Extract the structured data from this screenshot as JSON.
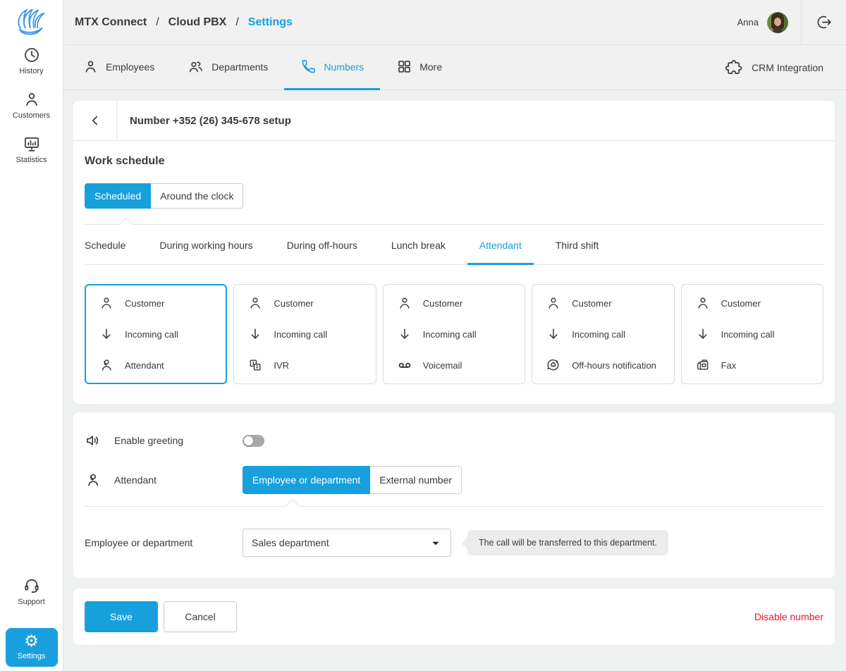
{
  "colors": {
    "accent": "#18a0dc",
    "danger": "#e8192c"
  },
  "header": {
    "breadcrumb": [
      "MTX Connect",
      "Cloud PBX",
      "Settings"
    ],
    "separator": "/",
    "user": "Anna"
  },
  "nav": {
    "tabs": [
      {
        "label": "Employees",
        "icon": "person"
      },
      {
        "label": "Departments",
        "icon": "people"
      },
      {
        "label": "Numbers",
        "icon": "phone",
        "active": true
      },
      {
        "label": "More",
        "icon": "grid"
      }
    ],
    "crm": "CRM Integration"
  },
  "sidebar": {
    "items": [
      {
        "label": "History",
        "icon": "history-clock"
      },
      {
        "label": "Customers",
        "icon": "person"
      },
      {
        "label": "Statistics",
        "icon": "monitor-chart"
      }
    ],
    "support": "Support",
    "settings": "Settings"
  },
  "number_setup": {
    "title": "Number +352 (26) 345-678 setup",
    "section": "Work schedule",
    "schedule_mode": {
      "options": [
        "Scheduled",
        "Around the clock"
      ],
      "active": "Scheduled"
    },
    "tabs": [
      "Schedule",
      "During working hours",
      "During off-hours",
      "Lunch break",
      "Attendant",
      "Third shift"
    ],
    "active_tab": "Attendant",
    "cards": [
      {
        "selected": true,
        "rows": [
          {
            "icon": "customer",
            "label": "Customer"
          },
          {
            "icon": "incoming-call",
            "label": "Incoming call"
          },
          {
            "icon": "attendant",
            "label": "Attendant"
          }
        ]
      },
      {
        "selected": false,
        "rows": [
          {
            "icon": "customer",
            "label": "Customer"
          },
          {
            "icon": "incoming-call",
            "label": "Incoming call"
          },
          {
            "icon": "ivr",
            "label": "IVR"
          }
        ]
      },
      {
        "selected": false,
        "rows": [
          {
            "icon": "customer",
            "label": "Customer"
          },
          {
            "icon": "incoming-call",
            "label": "Incoming call"
          },
          {
            "icon": "voicemail",
            "label": "Voicemail"
          }
        ]
      },
      {
        "selected": false,
        "rows": [
          {
            "icon": "customer",
            "label": "Customer"
          },
          {
            "icon": "incoming-call",
            "label": "Incoming call"
          },
          {
            "icon": "off-hours-notification",
            "label": "Off-hours notification"
          }
        ]
      },
      {
        "selected": false,
        "rows": [
          {
            "icon": "customer",
            "label": "Customer"
          },
          {
            "icon": "incoming-call",
            "label": "Incoming call"
          },
          {
            "icon": "fax",
            "label": "Fax"
          }
        ]
      }
    ]
  },
  "attendant_settings": {
    "greeting_label": "Enable greeting",
    "greeting_enabled": false,
    "attendant_label": "Attendant",
    "type_options": [
      "Employee or department",
      "External number"
    ],
    "type_active": "Employee or department",
    "target_label": "Employee or department",
    "target_value": "Sales department",
    "hint": "The call will be transferred to this department."
  },
  "footer_actions": {
    "save": "Save",
    "cancel": "Cancel",
    "disable": "Disable number"
  }
}
